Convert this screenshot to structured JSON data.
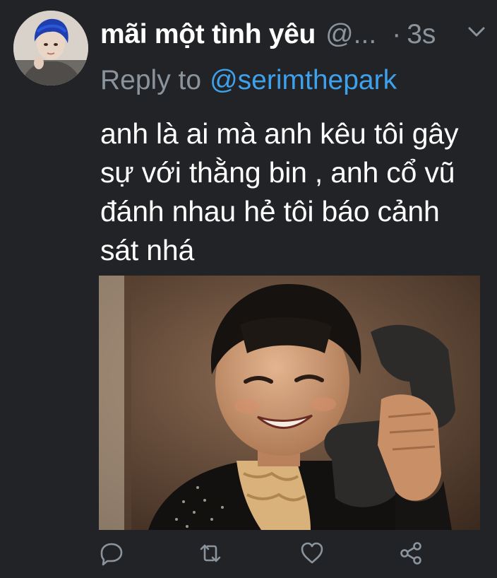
{
  "tweet": {
    "display_name": "mãi một tình yêu",
    "handle": "@...",
    "separator": "·",
    "timestamp": "3s",
    "reply_label": "Reply to",
    "reply_to": "@serimthepark",
    "text": "anh là ai mà anh kêu tôi gây\nsự với thằng bin , anh cổ vũ\nđánh nhau hẻ tôi báo cảnh\nsát nhá"
  },
  "icons": {
    "menu": "chevron-down-icon",
    "reply": "comment-icon",
    "retweet": "retweet-icon",
    "like": "heart-icon",
    "share": "share-icon"
  },
  "colors": {
    "background": "#222326",
    "secondary_text": "#8b949c",
    "link": "#3ea1ec",
    "primary_text": "#ffffff"
  }
}
